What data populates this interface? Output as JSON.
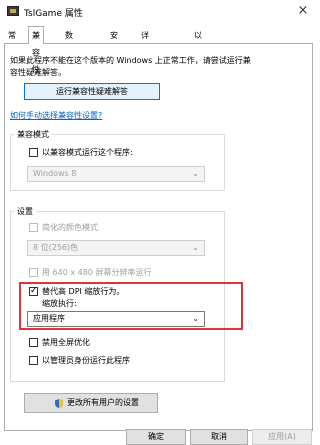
{
  "window": {
    "title": "TslGame 属性",
    "close_icon": "×"
  },
  "tabs": [
    {
      "label": "常规"
    },
    {
      "label": "兼容性"
    },
    {
      "label": "数字签名"
    },
    {
      "label": "安全"
    },
    {
      "label": "详细信息"
    },
    {
      "label": "以前的版本"
    }
  ],
  "active_tab": "兼容性",
  "description_line1": "如果此程序不能在这个版本的 Windows 上正常工作，请尝试运行兼",
  "description_line2": "容性疑难解答。",
  "run_troubleshooter_label": "运行兼容性疑难解答",
  "manual_settings_link": "如何手动选择兼容性设置?",
  "compat_mode": {
    "group_label": "兼容模式",
    "checkbox_label": "以兼容模式运行这个程序:",
    "checked": false,
    "os_select_value": "Windows 8"
  },
  "settings": {
    "group_label": "设置",
    "reduced_color_label": "简化的颜色模式",
    "color_select_value": "8 位(256)色",
    "run_640_label": "用 640 x 480 屏幕分辨率运行",
    "dpi_override_line1": "替代高 DPI 缩放行为。",
    "dpi_override_line2": "缩放执行:",
    "dpi_override_checked": true,
    "dpi_select_value": "应用程序",
    "disable_fullscreen_label": "禁用全屏优化",
    "run_as_admin_label": "以管理员身份运行此程序",
    "change_all_users_label": "更改所有用户的设置"
  },
  "footer": {
    "ok_label": "确定",
    "cancel_label": "取消",
    "apply_label": "应用(A)"
  },
  "colors": {
    "highlight": "#e0343a",
    "link": "#0066cc"
  }
}
